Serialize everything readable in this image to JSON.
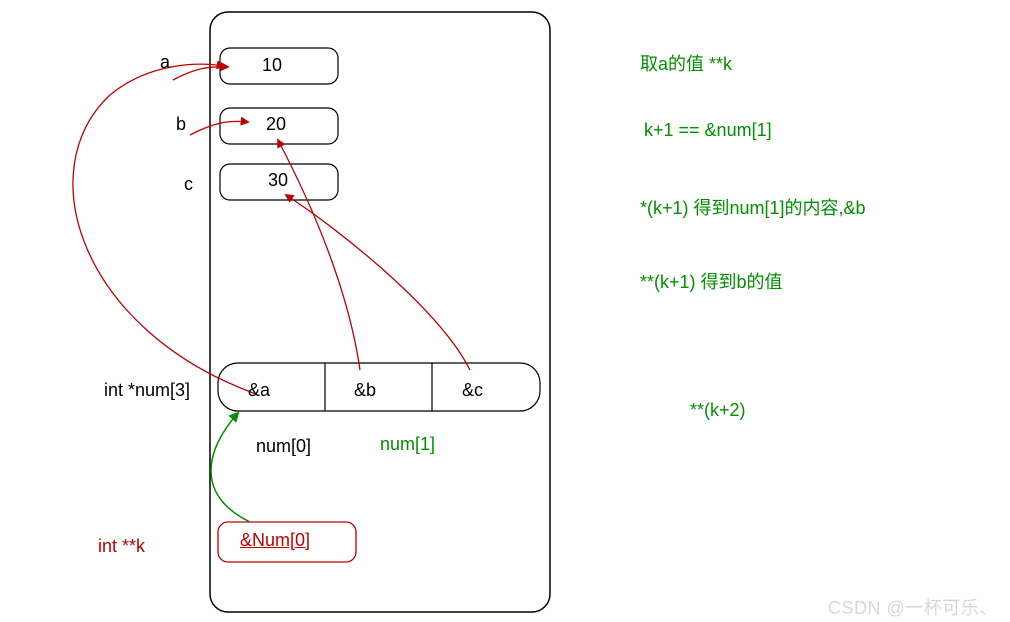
{
  "vars": {
    "a": {
      "label": "a",
      "value": "10"
    },
    "b": {
      "label": "b",
      "value": "20"
    },
    "c": {
      "label": "c",
      "value": "30"
    }
  },
  "array": {
    "decl": "int *num[3]",
    "cells": [
      "&a",
      "&b",
      "&c"
    ],
    "idxLabel0": "num[0]",
    "idxLabel1": "num[1]"
  },
  "k": {
    "decl": "int **k",
    "box": "&Num[0]"
  },
  "notes": {
    "n1": "取a的值  **k",
    "n2": "k+1   ==    &num[1]",
    "n3": "*(k+1) 得到num[1]的内容,&b",
    "n4": "**(k+1)  得到b的值",
    "n5": "**(k+2)"
  },
  "watermark": "CSDN @一杯可乐、"
}
